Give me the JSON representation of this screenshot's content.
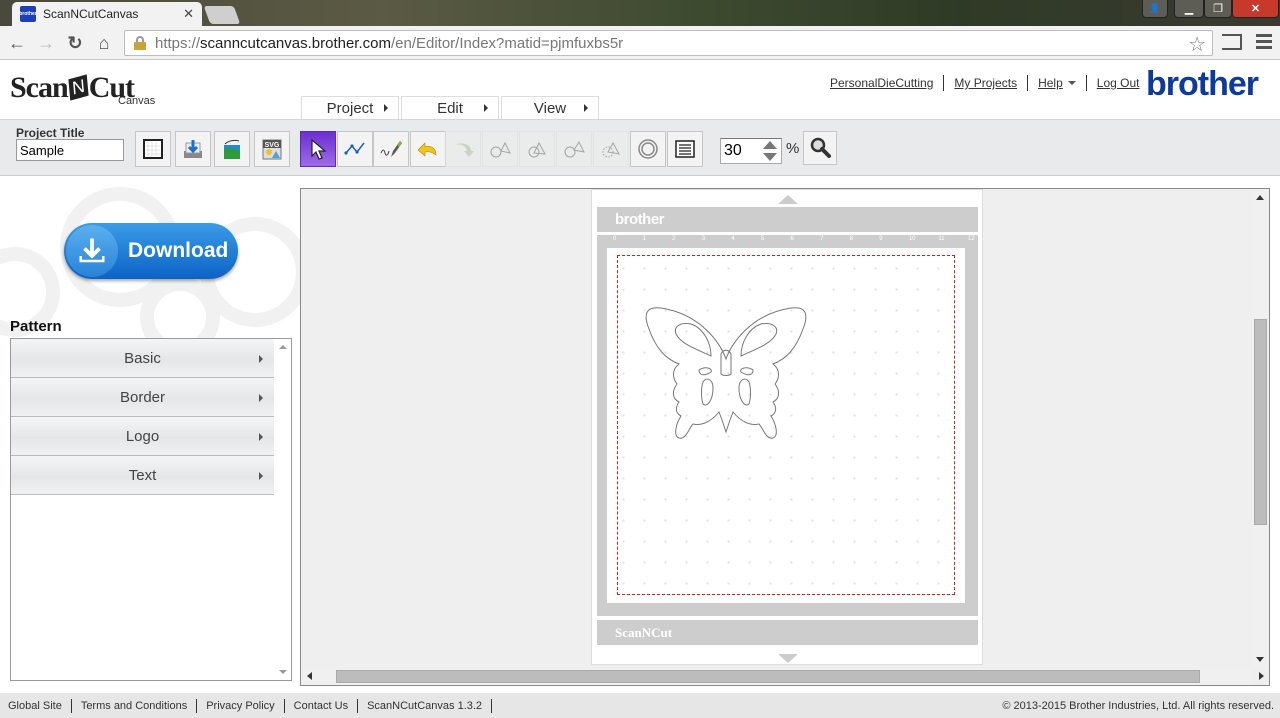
{
  "browser": {
    "tab_title": "ScanNCutCanvas",
    "tab_favicon_text": "brother",
    "url_scheme": "https://",
    "url_host": "scanncutcanvas.brother.com",
    "url_path": "/en/Editor/Index?matid=pjmfuxbs5r",
    "close_glyph": "✕",
    "back_glyph": "←",
    "forward_glyph": "→",
    "reload_glyph": "↻",
    "home_glyph": "⌂",
    "star_glyph": "☆",
    "win_min_glyph": "▁",
    "win_max_glyph": "❐",
    "win_close_glyph": "✕",
    "win_user_glyph": "👤"
  },
  "header": {
    "logo_text_scan": "Scan",
    "logo_text_n": "N",
    "logo_text_cut": "Cut",
    "logo_sub": "Canvas",
    "menus": [
      {
        "label": "Project"
      },
      {
        "label": "Edit"
      },
      {
        "label": "View"
      }
    ],
    "links": {
      "personal": "PersonalDieCutting",
      "my_projects": "My Projects",
      "help": "Help",
      "logout": "Log Out"
    },
    "brand": "brother",
    "brand_color": "#0d3a9e"
  },
  "toolbar": {
    "project_title_label": "Project Title",
    "project_title_value": "Sample",
    "zoom_value": "30",
    "zoom_unit": "%",
    "tools": [
      {
        "name": "new-mat",
        "state": "normal"
      },
      {
        "name": "download-to-computer",
        "state": "normal"
      },
      {
        "name": "import-image",
        "state": "normal"
      },
      {
        "name": "svg-import",
        "state": "normal",
        "text": "SVG"
      },
      {
        "name": "select",
        "state": "active"
      },
      {
        "name": "node-edit",
        "state": "normal"
      },
      {
        "name": "freehand-draw",
        "state": "normal"
      },
      {
        "name": "undo",
        "state": "normal"
      },
      {
        "name": "redo",
        "state": "disabled"
      },
      {
        "name": "weld",
        "state": "disabled"
      },
      {
        "name": "intersect",
        "state": "disabled"
      },
      {
        "name": "subtract",
        "state": "disabled"
      },
      {
        "name": "group",
        "state": "disabled"
      },
      {
        "name": "offset",
        "state": "disabled"
      },
      {
        "name": "object-list",
        "state": "normal"
      }
    ],
    "active_color": "#7a3fe0"
  },
  "sidebar": {
    "download_label": "Download",
    "pattern_label": "Pattern",
    "pattern_items": [
      {
        "label": "Basic"
      },
      {
        "label": "Border"
      },
      {
        "label": "Logo"
      },
      {
        "label": "Text"
      }
    ]
  },
  "canvas": {
    "mat_brand_top": "brother",
    "mat_brand_bottom": "ScanNCut",
    "ruler_top": [
      "0",
      "1",
      "2",
      "3",
      "4",
      "5",
      "6",
      "7",
      "8",
      "9",
      "10",
      "11",
      "12"
    ],
    "ruler_unit": "inch",
    "cut_line_color": "#d32020",
    "shape": "butterfly"
  },
  "footer": {
    "links": [
      "Global Site",
      "Terms and Conditions",
      "Privacy Policy",
      "Contact Us",
      "ScanNCutCanvas 1.3.2"
    ],
    "copyright": "© 2013-2015 Brother Industries, Ltd. All rights reserved."
  }
}
